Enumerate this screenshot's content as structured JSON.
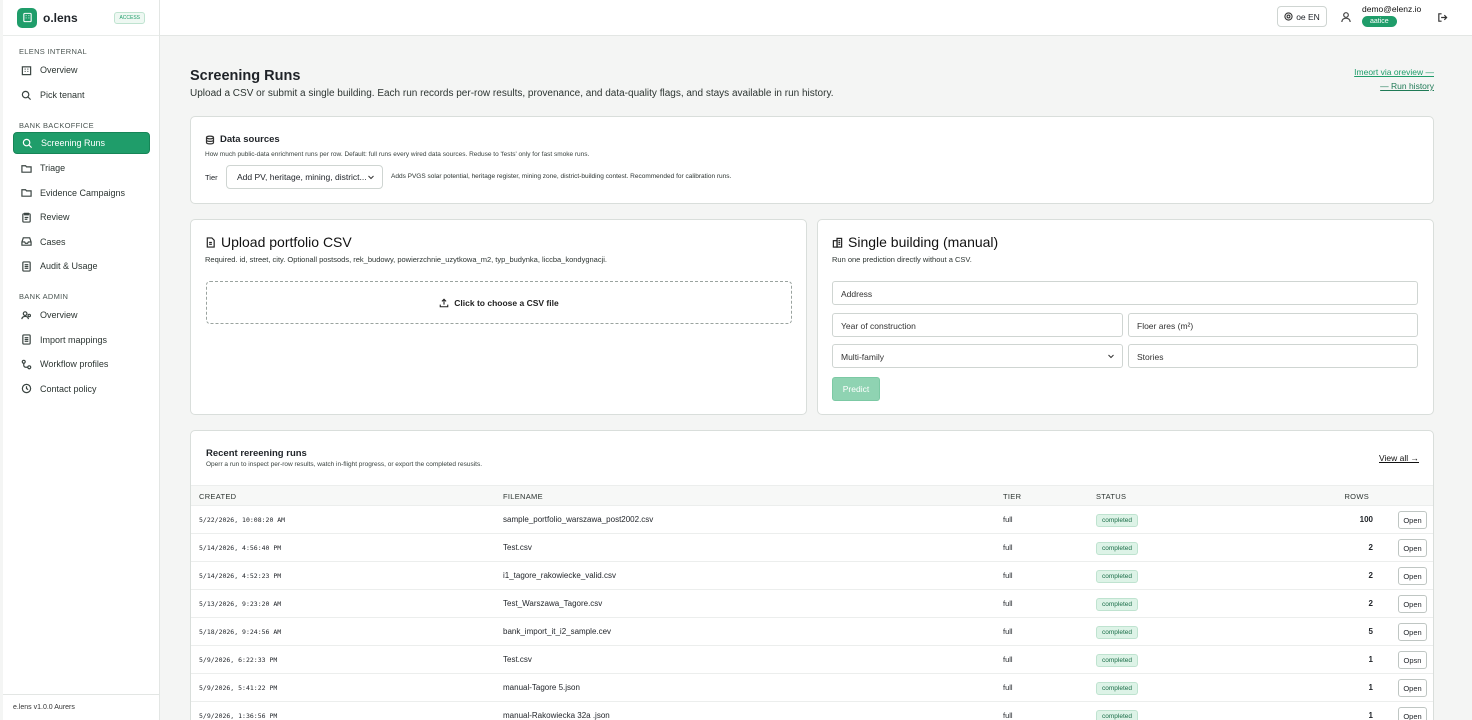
{
  "brand": {
    "name": "o.lens",
    "badge": "ACCESS"
  },
  "sidebar": {
    "section1": "ELENS INTERNAL",
    "internal": [
      "Overview",
      "Pick tenant"
    ],
    "section2": "BANK BACKOFFICE",
    "backoffice": [
      "Screening Runs",
      "Triage",
      "Evidence Campaigns",
      "Review",
      "Cases",
      "Audit & Usage"
    ],
    "section3": "BANK ADMIN",
    "admin": [
      "Overview",
      "Import mappings",
      "Workflow profiles",
      "Contact policy"
    ],
    "footer": "e.lens v1.0.0 Aurers"
  },
  "topbar": {
    "lang": "oe EN",
    "email": "demo@elenz.io",
    "role": "aatice"
  },
  "page": {
    "title": "Screening Runs",
    "subtitle": "Upload a CSV or submit a single building. Each run records per-row results, provenance, and data-quality flags, and stays available in run history.",
    "import_link": "Imeort via oreview —",
    "history_link": "— Run history"
  },
  "data_sources": {
    "title": "Data sources",
    "description": "How much public-data enrichment runs per row. Default: full  runs every wired data sources. Reduse to 'fests' only for fast smoke runs.",
    "tier_label": "Tier",
    "tier_value": "Add PV, heritage, mining, district...",
    "tier_note": "Adds PVGS solar potential, heritage register, mining zone, district-building contest. Recommended for calibration runs."
  },
  "upload": {
    "title": "Upload portfolio CSV",
    "subtitle": "Required. id, street, city. Optionall postsods, rek_budowy, powierzchnie_uzytkowa_m2, typ_budynka, liccba_kondygnacji.",
    "dropzone": "Click to choose a CSV file"
  },
  "single": {
    "title": "Single building (manual)",
    "subtitle": "Run one prediction directly without a CSV.",
    "address": "Address",
    "year": "Year of construction",
    "floor_area": "Floer ares (m²)",
    "type": "Multi-family",
    "stories": "Stories",
    "predict": "Predict"
  },
  "recent": {
    "title": "Recent rereening runs",
    "subtitle": "Operr a run to inspect per-row results, watch in-flight progress, or export the completed resusits.",
    "view_all": "View all →",
    "columns": [
      "CREATED",
      "FILENAME",
      "TIER",
      "STATUS",
      "ROWS"
    ],
    "rows": [
      {
        "created": "5/22/2026, 10:08:20 AM",
        "filename": "sample_portfolio_warszawa_post2002.csv",
        "tier": "full",
        "status": "completed",
        "rows": "100",
        "action": "Open"
      },
      {
        "created": "5/14/2026, 4:56:40 PM",
        "filename": "Test.csv",
        "tier": "full",
        "status": "completed",
        "rows": "2",
        "action": "Open"
      },
      {
        "created": "5/14/2026, 4:52:23 PM",
        "filename": "i1_tagore_rakowiecke_valid.csv",
        "tier": "full",
        "status": "completed",
        "rows": "2",
        "action": "Open"
      },
      {
        "created": "5/13/2026, 9:23:20 AM",
        "filename": "Test_Warszawa_Tagore.csv",
        "tier": "full",
        "status": "completed",
        "rows": "2",
        "action": "Open"
      },
      {
        "created": "5/18/2026, 9:24:56 AM",
        "filename": "bank_import_it_i2_sample.cev",
        "tier": "full",
        "status": "completed",
        "rows": "5",
        "action": "Open"
      },
      {
        "created": "5/9/2026, 6:22:33 PM",
        "filename": "Test.csv",
        "tier": "full",
        "status": "completed",
        "rows": "1",
        "action": "Opsn"
      },
      {
        "created": "5/9/2026, 5:41:22 PM",
        "filename": "manual-Tagore 5.json",
        "tier": "full",
        "status": "completed",
        "rows": "1",
        "action": "Open"
      },
      {
        "created": "5/9/2026, 1:36:56 PM",
        "filename": "manual-Rakowiecka 32a .json",
        "tier": "full",
        "status": "completed",
        "rows": "1",
        "action": "Open"
      }
    ]
  },
  "colors": {
    "accent": "#1f9d6a",
    "predict_disabled": "#8fd3b2",
    "badge_bg": "#ddf3e7"
  }
}
